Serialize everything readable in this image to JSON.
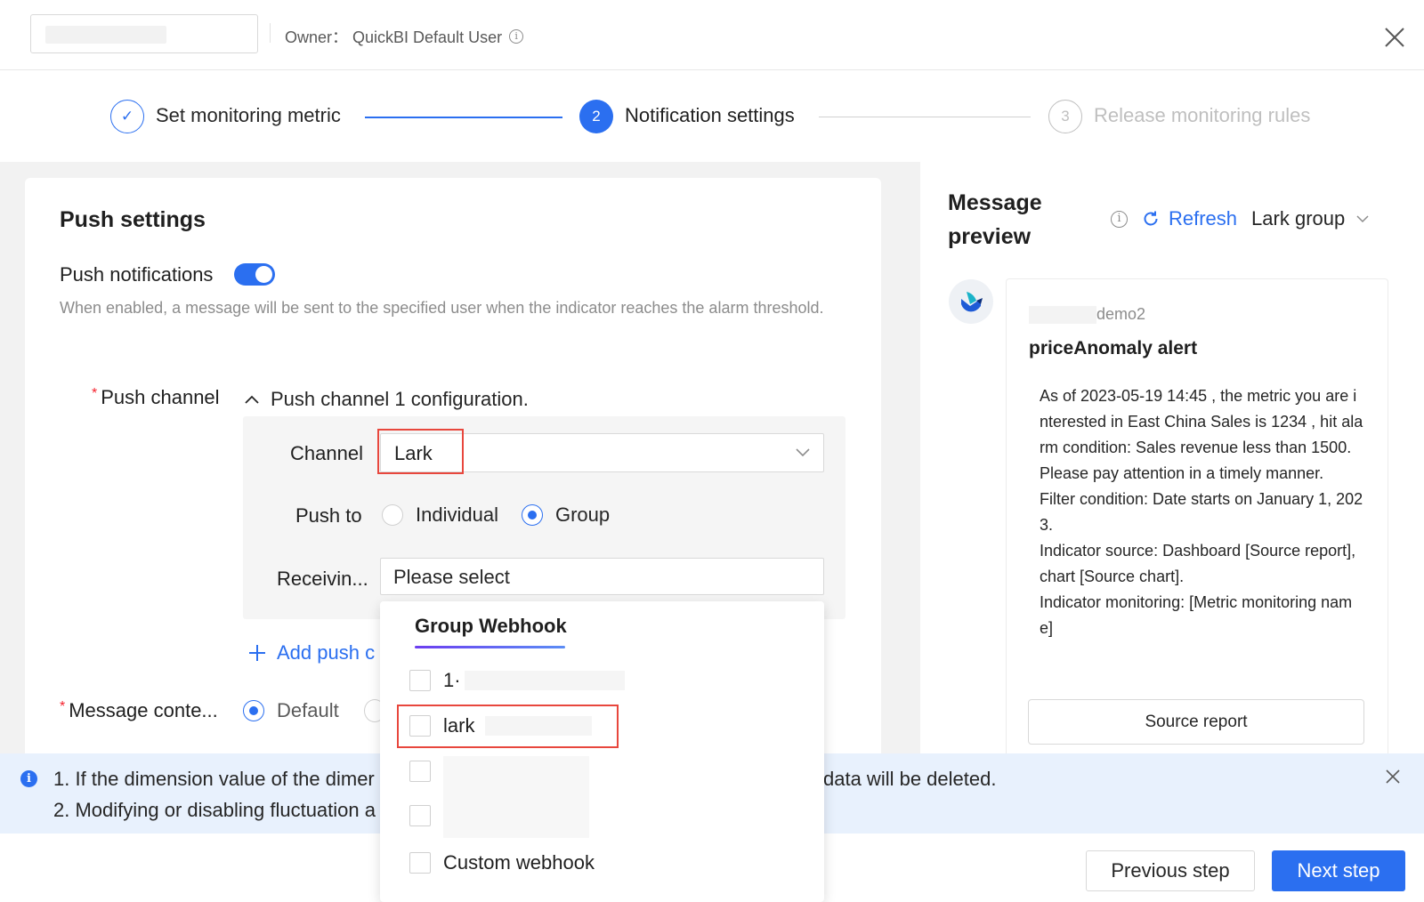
{
  "header": {
    "owner_text": "Owner： QuickBI Default User",
    "info_glyph": "i"
  },
  "steps": [
    {
      "number": "✓",
      "label": "Set monitoring metric",
      "state": "done"
    },
    {
      "number": "2",
      "label": "Notification settings",
      "state": "active"
    },
    {
      "number": "3",
      "label": "Release monitoring rules",
      "state": "pending"
    }
  ],
  "push_settings": {
    "title": "Push settings",
    "push_notifications_label": "Push notifications",
    "push_notifications_enabled": true,
    "description": "When enabled, a message will be sent to the specified user when the indicator reaches the alarm threshold.",
    "push_channel_label": "Push channel",
    "push_channel_config": "Push channel 1 configuration.",
    "channel_label": "Channel",
    "channel_value": "Lark",
    "push_to_label": "Push to",
    "push_to_options": [
      "Individual",
      "Group"
    ],
    "push_to_selected": "Group",
    "receiving_label": "Receivin...",
    "receiving_placeholder": "Please select",
    "add_push_label": "Add push c",
    "message_content_label": "Message conte...",
    "message_content_option": "Default"
  },
  "dropdown": {
    "tab_label": "Group Webhook",
    "items": [
      {
        "label": "1·"
      },
      {
        "label": "lark"
      },
      {
        "label": ""
      },
      {
        "label": ""
      },
      {
        "label": "Custom webhook"
      }
    ]
  },
  "preview": {
    "title": "Message preview",
    "refresh_label": "Refresh",
    "channel_select": "Lark group",
    "sender_suffix": "demo2",
    "alert_title": "priceAnomaly alert",
    "body_lines": [
      "As of 2023-05-19 14:45 , the metric you are interested in East China Sales is 1234 , hit alarm condition: Sales revenue less than 1500. Please pay attention in a timely manner.",
      "Filter condition: Date starts on January 1, 2023.",
      "Indicator source: Dashboard [Source report], chart [Source chart].",
      "Indicator monitoring: [Metric monitoring name]"
    ],
    "source_button": "Source report"
  },
  "notice": {
    "line1_start": "1. If the dimension value of the dimer",
    "line1_end": "data will be deleted.",
    "line2": "2. Modifying or disabling fluctuation a"
  },
  "footer": {
    "previous_label": "Previous step",
    "next_label": "Next step"
  },
  "colors": {
    "primary": "#2b6ff0",
    "highlight_red": "#e8473d",
    "notice_bg": "#e8f1fd"
  }
}
